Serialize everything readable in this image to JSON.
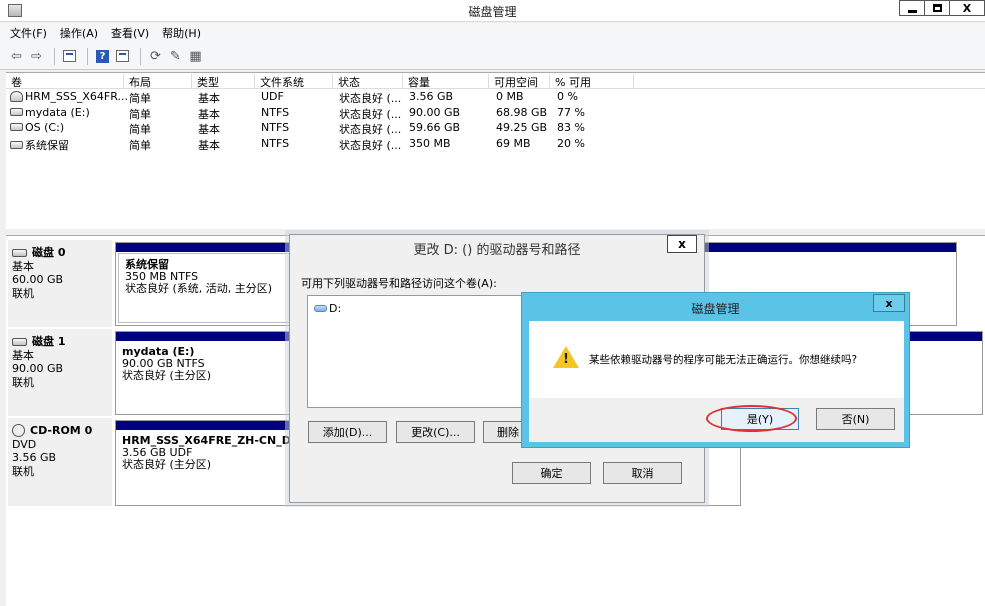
{
  "window": {
    "title": "磁盘管理"
  },
  "menu": [
    "文件(F)",
    "操作(A)",
    "查看(V)",
    "帮助(H)"
  ],
  "toolbar": {
    "icons": [
      "back-arrow-icon",
      "forward-arrow-icon",
      "console-tree-icon",
      "help-icon",
      "properties-icon",
      "refresh-icon",
      "export-icon",
      "disk-settings-icon"
    ]
  },
  "volumes": {
    "headers": [
      "卷",
      "布局",
      "类型",
      "文件系统",
      "状态",
      "容量",
      "可用空间",
      "% 可用"
    ],
    "rows": [
      [
        "HRM_SSS_X64FR...",
        "简单",
        "基本",
        "UDF",
        "状态良好 (...",
        "3.56 GB",
        "0 MB",
        "0 %"
      ],
      [
        "mydata (E:)",
        "简单",
        "基本",
        "NTFS",
        "状态良好 (...",
        "90.00 GB",
        "68.98 GB",
        "77 %"
      ],
      [
        "OS (C:)",
        "简单",
        "基本",
        "NTFS",
        "状态良好 (...",
        "59.66 GB",
        "49.25 GB",
        "83 %"
      ],
      [
        "系统保留",
        "简单",
        "基本",
        "NTFS",
        "状态良好 (...",
        "350 MB",
        "69 MB",
        "20 %"
      ]
    ]
  },
  "disks": [
    {
      "name": "磁盘 0",
      "type": "基本",
      "size": "60.00 GB",
      "state": "联机",
      "part": {
        "name": "系统保留",
        "size": "350 MB NTFS",
        "status": "状态良好 (系统, 活动, 主分区)"
      }
    },
    {
      "name": "磁盘 1",
      "type": "基本",
      "size": "90.00 GB",
      "state": "联机",
      "part": {
        "name": "mydata  (E:)",
        "size": "90.00 GB NTFS",
        "status": "状态良好 (主分区)"
      }
    },
    {
      "name": "CD-ROM 0",
      "type": "DVD",
      "size": "3.56 GB",
      "state": "联机",
      "part": {
        "name": "HRM_SSS_X64FRE_ZH-CN_DV5",
        "size": "3.56 GB UDF",
        "status": "状态良好 (主分区)"
      }
    }
  ],
  "dialog_change": {
    "title": "更改 D: () 的驱动器号和路径",
    "close": "x",
    "prompt": "可用下列驱动器号和路径访问这个卷(A):",
    "item": "D:",
    "add": "添加(D)...",
    "change": "更改(C)...",
    "remove": "删除",
    "ok": "确定",
    "cancel": "取消"
  },
  "dialog_confirm": {
    "title": "磁盘管理",
    "close": "x",
    "message": "某些依赖驱动器号的程序可能无法正确运行。你想继续吗?",
    "yes": "是(Y)",
    "no": "否(N)"
  }
}
